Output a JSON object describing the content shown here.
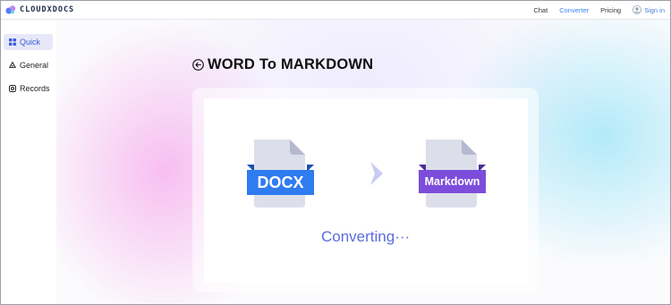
{
  "header": {
    "logo_text": "CLOUDXDOCS",
    "nav": {
      "chat": "Chat",
      "converter": "Converter",
      "pricing": "Pricing",
      "signin": "Sign in"
    }
  },
  "sidebar": {
    "items": [
      {
        "label": "Quick",
        "icon": "grid-icon",
        "active": true
      },
      {
        "label": "General",
        "icon": "recycle-icon",
        "active": false
      },
      {
        "label": "Records",
        "icon": "record-icon",
        "active": false
      }
    ]
  },
  "main": {
    "title": "WORD To MARKDOWN",
    "source_format": "DOCX",
    "target_format": "Markdown",
    "status": "Converting···"
  },
  "colors": {
    "accent": "#3b82f6",
    "docx_label": "#2f7bf0",
    "markdown_label": "#7c4ddb",
    "status_text": "#5b6be0",
    "arrow": "#c7cbf5"
  }
}
